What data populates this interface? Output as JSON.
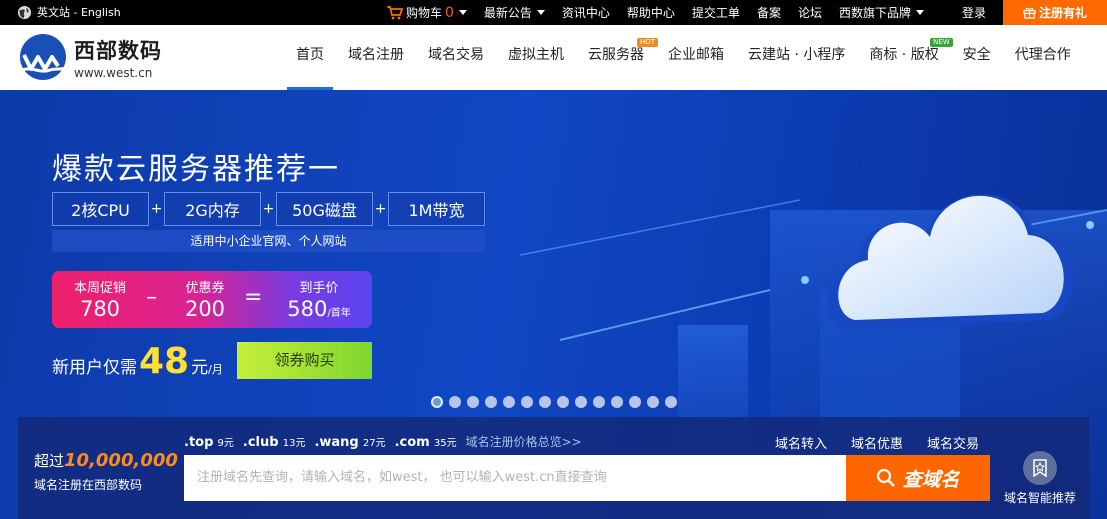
{
  "topbar": {
    "lang_label": "英文站 - English",
    "cart_label": "购物车",
    "cart_count": "0",
    "items": [
      "最新公告",
      "资讯中心",
      "帮助中心",
      "提交工单",
      "备案",
      "论坛",
      "西数旗下品牌",
      "登录"
    ],
    "register_label": "注册有礼"
  },
  "logo": {
    "name": "西部数码",
    "url_text": "www.west.cn"
  },
  "nav": {
    "items": [
      {
        "label": "首页"
      },
      {
        "label": "域名注册"
      },
      {
        "label": "域名交易"
      },
      {
        "label": "虚拟主机"
      },
      {
        "label": "云服务器",
        "tag": "HOT"
      },
      {
        "label": "企业邮箱"
      },
      {
        "label": "云建站 · 小程序"
      },
      {
        "label": "商标 · 版权",
        "tag": "NEW"
      },
      {
        "label": "安全"
      },
      {
        "label": "代理合作"
      }
    ]
  },
  "banner": {
    "headline": "爆款云服务器推荐一",
    "specs": [
      "2核CPU",
      "2G内存",
      "50G磁盘",
      "1M带宽"
    ],
    "plus": "+",
    "subline": "适用中小企业官网、个人网站",
    "promo_label": "本周促销",
    "promo_value": "780",
    "minus": "–",
    "coupon_label": "优惠券",
    "coupon_value": "200",
    "equals": "=",
    "final_label": "到手价",
    "final_value": "580",
    "final_unit": "/首年",
    "newuser_prefix": "新用户仅需",
    "newuser_price": "48",
    "newuser_unit": "元",
    "newuser_per": "/月",
    "buy_label": "领券购买",
    "slides_total": 14,
    "slide_active": 1
  },
  "domain": {
    "count_prefix": "超过",
    "count_value": "10,000,000",
    "count_sub": "域名注册在西部数码",
    "tlds": [
      {
        "name": ".top",
        "price": "9元"
      },
      {
        "name": ".club",
        "price": "13元"
      },
      {
        "name": ".wang",
        "price": "27元"
      },
      {
        "name": ".com",
        "price": "35元"
      }
    ],
    "overview_label": "域名注册价格总览>>",
    "links": [
      "域名转入",
      "域名优惠",
      "域名交易"
    ],
    "search_placeholder": "注册域名先查询，请输入域名，如west， 也可以输入west.cn直接查询",
    "search_button": "查域名",
    "smart_label": "域名智能推荐"
  },
  "colors": {
    "accent": "#ff6600",
    "brand_blue": "#1f6fd6",
    "price_yellow": "#ffe033"
  }
}
